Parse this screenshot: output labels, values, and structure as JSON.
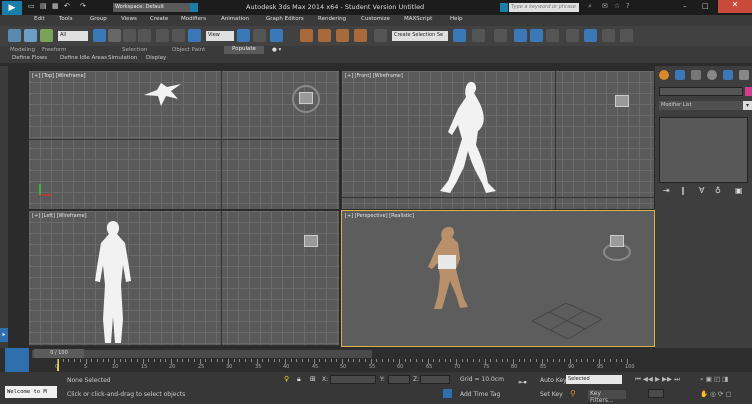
{
  "title_bar": {
    "workspace": "Workspace: Default",
    "app_title": "Autodesk 3ds Max  2014 x64  -  Student Version    Untitled",
    "search_placeholder": "Type a keyword or phrase"
  },
  "menu": [
    "Edit",
    "Tools",
    "Group",
    "Views",
    "Create",
    "Modifiers",
    "Animation",
    "Graph Editors",
    "Rendering",
    "Customize",
    "MAXScript",
    "Help"
  ],
  "toolbar": {
    "filter": "All",
    "view_dropdown": "View",
    "selection_set": "Create Selection Se"
  },
  "ribbon": {
    "tabs": [
      "Modeling",
      "Freeform",
      "Selection",
      "Object Paint",
      "Populate"
    ],
    "sub_tabs": [
      "Define Flows",
      "Define Idle Areas",
      "Simulation",
      "Display"
    ]
  },
  "viewports": {
    "top": "[+] [Top] [Wireframe]",
    "front": "[+] [Front] [Wireframe]",
    "left": "[+] [Left] [Wireframe]",
    "perspective": "[+] [Perspective] [Realistic]"
  },
  "command_panel": {
    "modifier_list": "Modifier List"
  },
  "timeline": {
    "frame_counter": "0 / 100",
    "ticks": [
      "0",
      "5",
      "10",
      "15",
      "20",
      "25",
      "30",
      "35",
      "40",
      "45",
      "50",
      "55",
      "60",
      "65",
      "70",
      "75",
      "80",
      "85",
      "90",
      "95",
      "100"
    ]
  },
  "status": {
    "maxscript": "Welcome to M",
    "selection": "None Selected",
    "prompt": "Click or click-and-drag to select objects",
    "x_label": "X:",
    "y_label": "Y:",
    "z_label": "Z:",
    "grid": "Grid = 10.0cm",
    "add_time_tag": "Add Time Tag",
    "auto_key": "Auto Key",
    "selected": "Selected",
    "set_key": "Set Key",
    "key_filters": "Key Filters..."
  },
  "colors": {
    "accent": "#1a7fa8",
    "active_viewport_border": "#d8b24a",
    "viewport_bg": "#5a5a5a"
  }
}
